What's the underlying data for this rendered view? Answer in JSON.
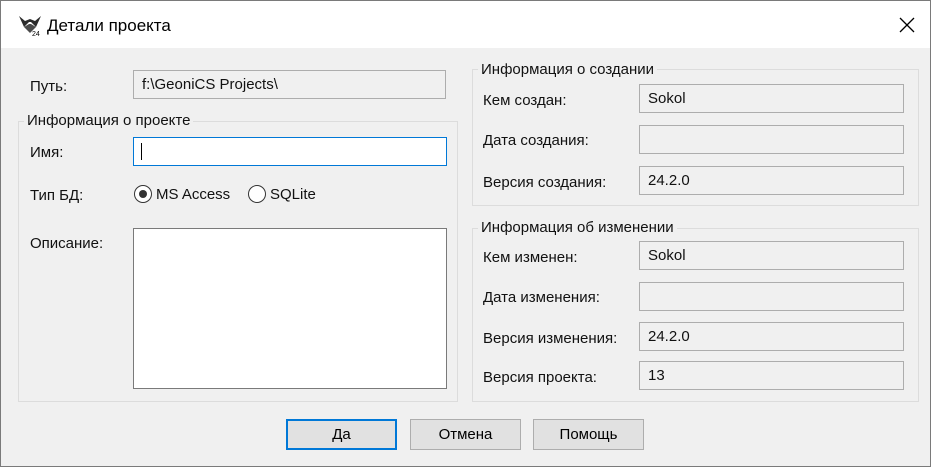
{
  "window": {
    "title": "Детали проекта"
  },
  "path": {
    "label": "Путь:",
    "value": "f:\\GeoniCS Projects\\"
  },
  "project_info": {
    "group_title": "Информация о проекте",
    "name_label": "Имя:",
    "name_value": "",
    "db_type_label": "Тип БД:",
    "db_options": [
      "MS Access",
      "SQLite"
    ],
    "db_selected": "MS Access",
    "description_label": "Описание:",
    "description_value": ""
  },
  "creation_info": {
    "group_title": "Информация о создании",
    "created_by_label": "Кем создан:",
    "created_by_value": "Sokol",
    "created_date_label": "Дата создания:",
    "created_date_value": "",
    "created_version_label": "Версия создания:",
    "created_version_value": "24.2.0"
  },
  "change_info": {
    "group_title": "Информация об изменении",
    "changed_by_label": "Кем изменен:",
    "changed_by_value": "Sokol",
    "changed_date_label": "Дата изменения:",
    "changed_date_value": "",
    "changed_version_label": "Версия изменения:",
    "changed_version_value": "24.2.0",
    "project_version_label": "Версия проекта:",
    "project_version_value": "13"
  },
  "buttons": {
    "ok": "Да",
    "cancel": "Отмена",
    "help": "Помощь"
  },
  "icons": {
    "app": "geonics-app-icon",
    "close": "close-icon"
  },
  "colors": {
    "focus_border": "#0078d7",
    "dialog_bg": "#f0f0f0"
  }
}
